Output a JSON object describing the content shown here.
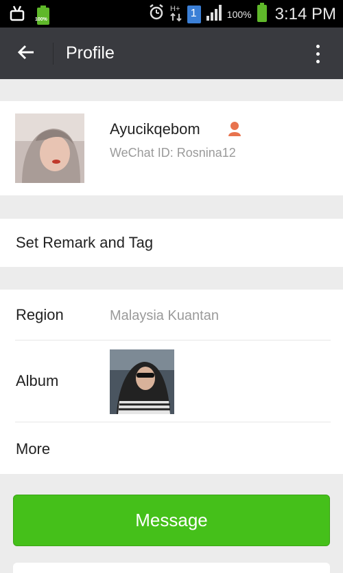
{
  "status_bar": {
    "battery_percent": "100%",
    "time": "3:14 PM",
    "sim_label": "1",
    "battery_small_label": "100%",
    "icons": [
      "android-icon",
      "battery-full-icon",
      "alarm-icon",
      "data-arrows-icon",
      "sim-icon",
      "signal-icon",
      "battery-icon"
    ]
  },
  "app_bar": {
    "title": "Profile",
    "back_icon": "arrow-left-icon",
    "menu_icon": "more-vert-icon"
  },
  "profile": {
    "name": "Ayucikqebom",
    "wechat_id": "WeChat ID: Rosnina12",
    "gender_icon": "female-icon",
    "gender_color": "#e8734e"
  },
  "remark": {
    "label": "Set Remark and Tag"
  },
  "info": {
    "region_label": "Region",
    "region_value": "Malaysia  Kuantan",
    "album_label": "Album",
    "more_label": "More"
  },
  "actions": {
    "message_label": "Message",
    "message_color": "#45c01a"
  }
}
